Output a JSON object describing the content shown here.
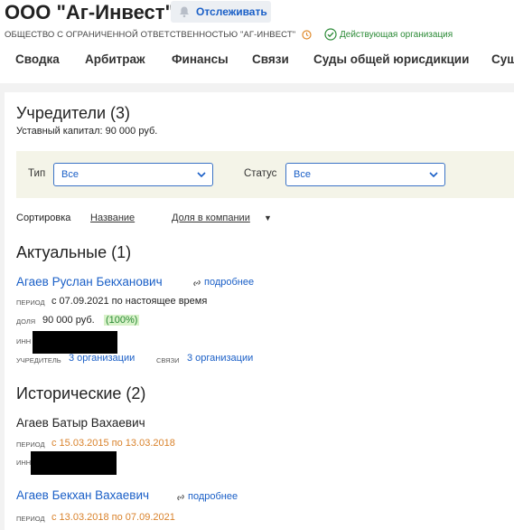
{
  "header": {
    "title": "ООО \"Аг-Инвест\"",
    "follow_button": "Отслеживать",
    "full_name": "ОБЩЕСТВО С ОГРАНИЧЕННОЙ ОТВЕТСТВЕННОСТЬЮ \"АГ-ИНВЕСТ\"",
    "status": "Действующая организация",
    "status_color": "#2b8a36",
    "accent_color": "#1a5fc7"
  },
  "tabs": [
    "Сводка",
    "Арбитраж",
    "Финансы",
    "Связи",
    "Суды общей юрисдикции",
    "Сущ"
  ],
  "founders": {
    "title": "Учредители (3)",
    "capital": "Уставный капитал: 90 000 руб.",
    "filter_type_label": "Тип",
    "filter_type_value": "Все",
    "filter_status_label": "Статус",
    "filter_status_value": "Все",
    "sort_label": "Сортировка",
    "sort_by_name": "Название",
    "sort_by_share": "Доля в компании",
    "actual_title": "Актуальные (1)",
    "historical_title": "Исторические (2)",
    "more_label": "подробнее",
    "period_label": "ПЕРИОД",
    "share_label": "ДОЛЯ",
    "inn_label": "ИНН",
    "founder_label": "УЧРЕДИТЕЛЬ",
    "links_label": "СВЯЗИ",
    "actual": [
      {
        "name": "Агаев Руслан Бекханович",
        "period": "с 07.09.2021 по настоящее время",
        "share": "90 000 руб.",
        "share_percent": "(100%)",
        "founder_orgs": "3 организации",
        "links_orgs": "3 организации"
      }
    ],
    "historical": [
      {
        "name": "Агаев Батыр Вахаевич",
        "period": "с 15.03.2015 по 13.03.2018"
      },
      {
        "name": "Агаев Бекхан Вахаевич",
        "period": "с 13.03.2018 по 07.09.2021"
      }
    ]
  }
}
